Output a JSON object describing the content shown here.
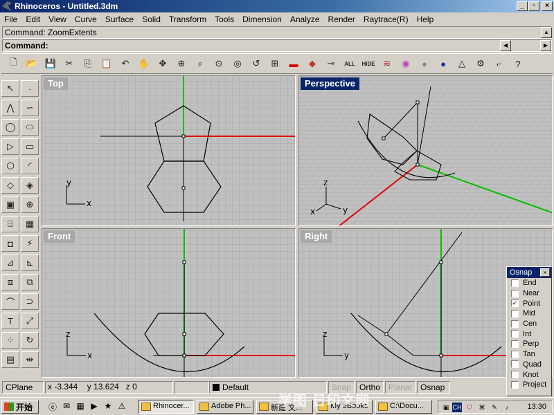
{
  "window": {
    "title": "Rhinoceros - Untitled.3dm"
  },
  "menu": [
    "File",
    "Edit",
    "View",
    "Curve",
    "Surface",
    "Solid",
    "Transform",
    "Tools",
    "Dimension",
    "Analyze",
    "Render",
    "Raytrace(R)",
    "Help"
  ],
  "command": {
    "history": "Command: ZoomExtents",
    "prompt": "Command:"
  },
  "toolbar": {
    "all_label": "ALL",
    "hide_label": "HIDE"
  },
  "viewports": {
    "top": {
      "title": "Top",
      "axis_x": "x",
      "axis_y": "y"
    },
    "perspective": {
      "title": "Perspective",
      "axis_x": "x",
      "axis_y": "y",
      "axis_z": "z"
    },
    "front": {
      "title": "Front",
      "axis_x": "x",
      "axis_z": "z"
    },
    "right": {
      "title": "Right",
      "axis_y": "y",
      "axis_z": "z"
    }
  },
  "osnap": {
    "title": "Osnap",
    "items": [
      {
        "label": "End",
        "checked": false
      },
      {
        "label": "Near",
        "checked": false
      },
      {
        "label": "Point",
        "checked": true
      },
      {
        "label": "Mid",
        "checked": false
      },
      {
        "label": "Cen",
        "checked": false
      },
      {
        "label": "Int",
        "checked": false
      },
      {
        "label": "Perp",
        "checked": false
      },
      {
        "label": "Tan",
        "checked": false
      },
      {
        "label": "Quad",
        "checked": false
      },
      {
        "label": "Knot",
        "checked": false
      },
      {
        "label": "Project",
        "checked": false
      }
    ]
  },
  "status": {
    "cplane": "CPlane",
    "x": "x -3.344",
    "y": "y 13.624",
    "z": "z 0",
    "layer": "Default",
    "snap": "Snap",
    "ortho": "Ortho",
    "planar": "Planar",
    "osnap": "Osnap"
  },
  "taskbar": {
    "start": "开始",
    "tasks": [
      "Rhinocer...",
      "Adobe Ph...",
      "新建 文...",
      "My eBooks",
      "C:\\Docu..."
    ],
    "tray_lang": "CH",
    "clock": "13:30"
  },
  "watermark": "学图 日印文网",
  "colors": {
    "title_active": "#0a246a",
    "axis_x": "#e00000",
    "axis_y": "#00c000",
    "viewport_bg": "#c0c0c0",
    "grid": "#a8a8a8"
  }
}
